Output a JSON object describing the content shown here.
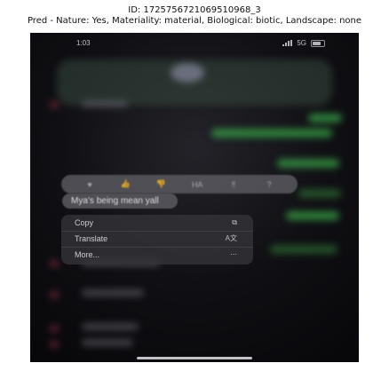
{
  "caption": {
    "line1": "ID: 1725756721069510968_3",
    "line2": "Pred - Nature: Yes, Materiality: material, Biological: biotic, Landscape: none"
  },
  "status_bar": {
    "time": "1:03",
    "network": "5G"
  },
  "reaction_bar": {
    "reactions": [
      {
        "icon": "heart-icon",
        "glyph": "♥"
      },
      {
        "icon": "thumbs-up-icon",
        "glyph": "👍"
      },
      {
        "icon": "thumbs-down-icon",
        "glyph": "👎"
      },
      {
        "icon": "haha-icon",
        "glyph": "HA"
      },
      {
        "icon": "emphasis-icon",
        "glyph": "‼"
      },
      {
        "icon": "question-icon",
        "glyph": "?"
      }
    ]
  },
  "message": {
    "text": "Mya’s being mean yall"
  },
  "context_menu": {
    "items": [
      {
        "label": "Copy",
        "icon": "copy-icon",
        "glyph": "⧉"
      },
      {
        "label": "Translate",
        "icon": "translate-icon",
        "glyph": "A文"
      },
      {
        "label": "More...",
        "icon": "more-icon",
        "glyph": "⋯"
      }
    ]
  },
  "colors": {
    "background": "#07070a",
    "menu": "#333338",
    "accent_green": "#3aa848",
    "text": "#e1e1e8"
  }
}
